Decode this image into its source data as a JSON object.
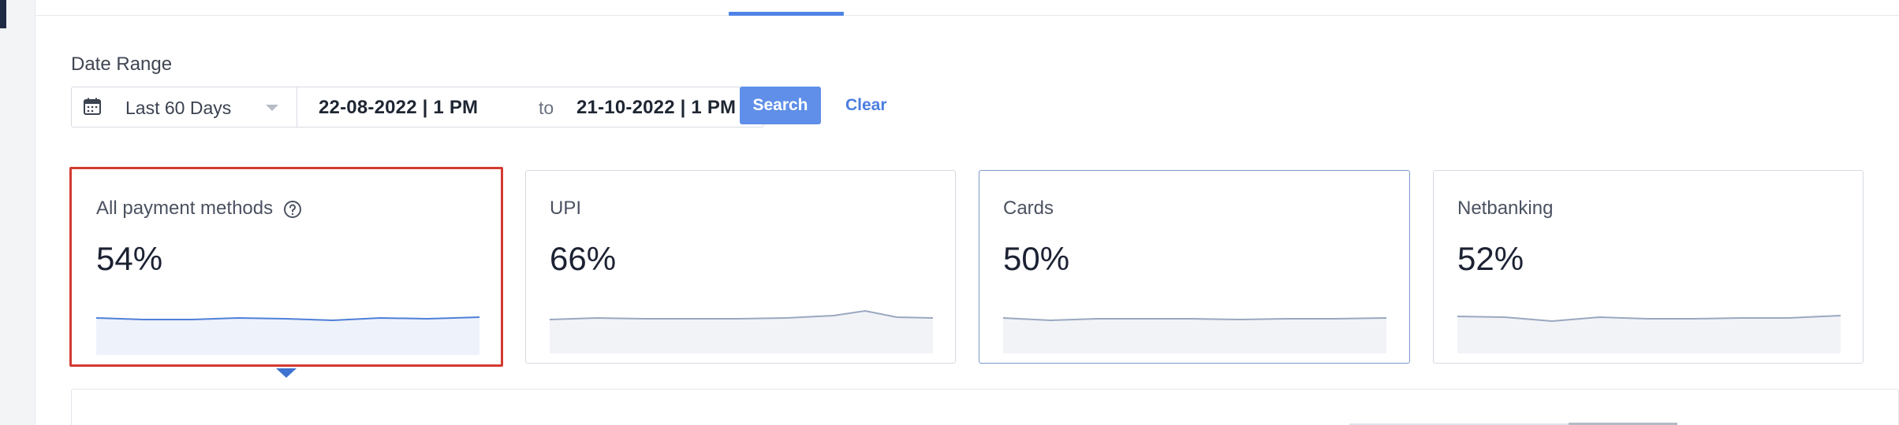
{
  "filters": {
    "date_range_label": "Date Range",
    "range_option": "Last 60 Days",
    "from_date": "22-08-2022 | 1 PM",
    "to_text": "to",
    "to_date": "21-10-2022 | 1 PM",
    "search_label": "Search",
    "clear_label": "Clear"
  },
  "cards": [
    {
      "title": "All payment methods",
      "value": "54%",
      "selected": true
    },
    {
      "title": "UPI",
      "value": "66%"
    },
    {
      "title": "Cards",
      "value": "50%"
    },
    {
      "title": "Netbanking",
      "value": "52%"
    }
  ],
  "colors": {
    "accent": "#5f8fe8",
    "selected_border": "#d33a32",
    "spark_line": "#4f7fd8"
  },
  "icons": {
    "calendar": "calendar-icon",
    "help": "help-circle-icon",
    "caret": "caret-down-icon"
  }
}
